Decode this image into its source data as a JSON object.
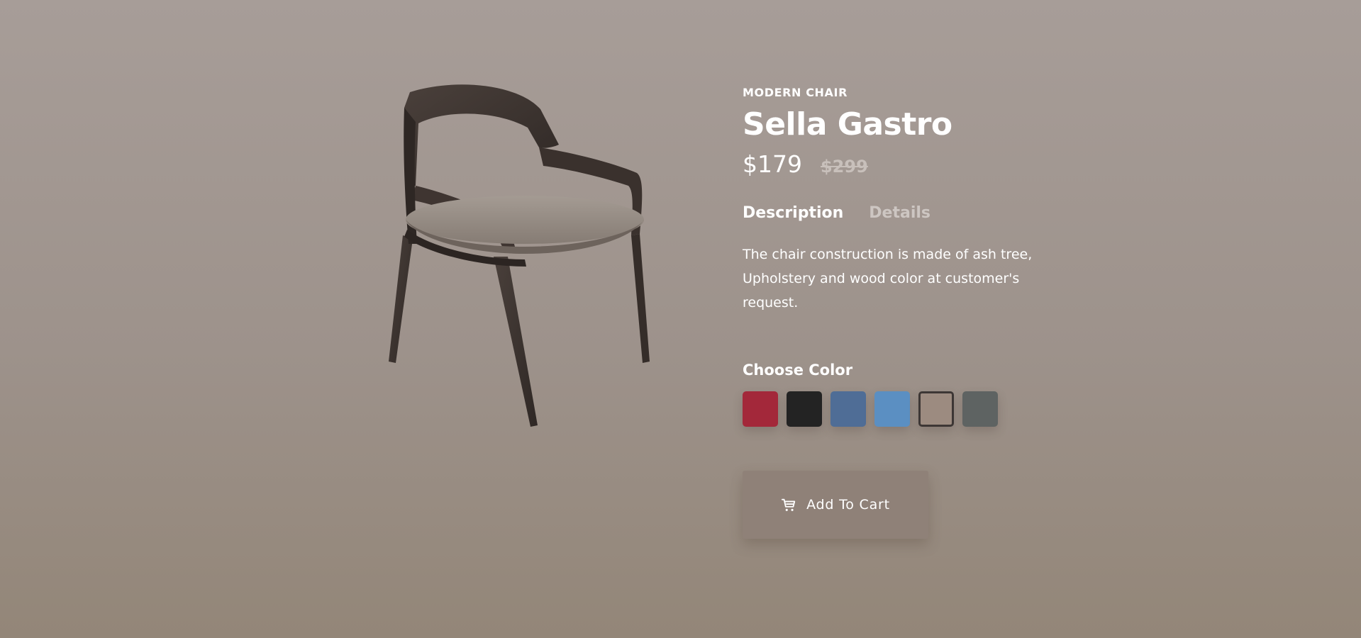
{
  "product": {
    "category": "MODERN CHAIR",
    "name": "Sella Gastro",
    "price": "$179",
    "old_price": "$299"
  },
  "tabs": [
    {
      "label": "Description",
      "active": true
    },
    {
      "label": "Details",
      "active": false
    }
  ],
  "description": "The chair construction is made of ash tree, Upholstery and wood color at customer's request.",
  "color_picker": {
    "label": "Choose Color",
    "swatches": [
      {
        "name": "red",
        "color": "#a3283a",
        "selected": false
      },
      {
        "name": "black",
        "color": "#232323",
        "selected": false
      },
      {
        "name": "denim-blue",
        "color": "#4f6d96",
        "selected": false
      },
      {
        "name": "light-blue",
        "color": "#5b8fc2",
        "selected": false
      },
      {
        "name": "taupe",
        "color": "#9c8b80",
        "selected": true
      },
      {
        "name": "grey",
        "color": "#5e6362",
        "selected": false
      }
    ]
  },
  "cart": {
    "label": "Add To Cart",
    "icon": "cart-icon"
  },
  "image": {
    "icon": "chair-image"
  },
  "colors": {
    "background_top": "#a79d98",
    "background_bottom": "#938678",
    "button_bg": "#8f8178",
    "text": "#ffffff"
  }
}
